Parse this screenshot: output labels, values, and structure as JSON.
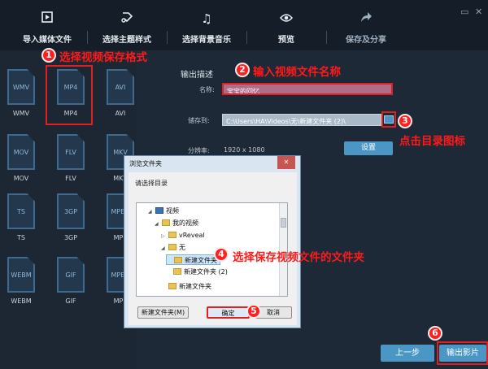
{
  "nav": {
    "items": [
      {
        "label": "导入媒体文件",
        "icon": "import-media-icon"
      },
      {
        "label": "选择主题样式",
        "icon": "theme-style-icon"
      },
      {
        "label": "选择背景音乐",
        "icon": "music-note-icon"
      },
      {
        "label": "预览",
        "icon": "eye-icon"
      },
      {
        "label": "保存及分享",
        "icon": "share-arrow-icon"
      }
    ]
  },
  "formats": [
    "WMV",
    "MP4",
    "AVI",
    "MOV",
    "FLV",
    "MKV",
    "TS",
    "3GP",
    "MPEG",
    "WEBM",
    "GIF",
    "MPEG"
  ],
  "format_labels": [
    "WMV",
    "MP4",
    "AVI",
    "MOV",
    "FLV",
    "MKV",
    "TS",
    "3GP",
    "MPE",
    "WEBM",
    "GIF",
    "MPE"
  ],
  "form": {
    "title": "输出描述",
    "name_label": "名称:",
    "name_value": "宝宝的回忆",
    "path_label": "储存到:",
    "path_value": "C:\\Users\\HA\\Videos\\无\\新建文件夹 (2)\\",
    "res_label": "分辨率:",
    "res_value": "1920 x 1080",
    "settings_button": "设置"
  },
  "dialog": {
    "title": "浏览文件夹",
    "prompt": "请选择目录",
    "tree": [
      {
        "label": "视频",
        "twisty": "◢"
      },
      {
        "label": "我的视频",
        "twisty": "◢"
      },
      {
        "label": "vReveal",
        "twisty": "▷"
      },
      {
        "label": "无",
        "twisty": "◢"
      },
      {
        "label": "新建文件夹",
        "twisty": ""
      },
      {
        "label": "新建文件夹 (2)",
        "twisty": ""
      },
      {
        "label": "新建文件夹",
        "twisty": ""
      }
    ],
    "new_folder_button": "新建文件夹(M)",
    "ok_button": "确定",
    "cancel_button": "取消",
    "close_glyph": "✕"
  },
  "footer": {
    "prev_button": "上一步",
    "export_button": "输出影片"
  },
  "annotations": {
    "n1": "1",
    "t1": "选择视频保存格式",
    "n2": "2",
    "t2": "输入视频文件名称",
    "n3": "3",
    "t3": "点击目录图标",
    "n4": "4",
    "t4": "选择保存视频文件的文件夹",
    "n5": "5",
    "n6": "6"
  },
  "colors": {
    "accent": "#4a97c6",
    "annotation_red": "#ff1a1a",
    "background": "#1d2936"
  }
}
